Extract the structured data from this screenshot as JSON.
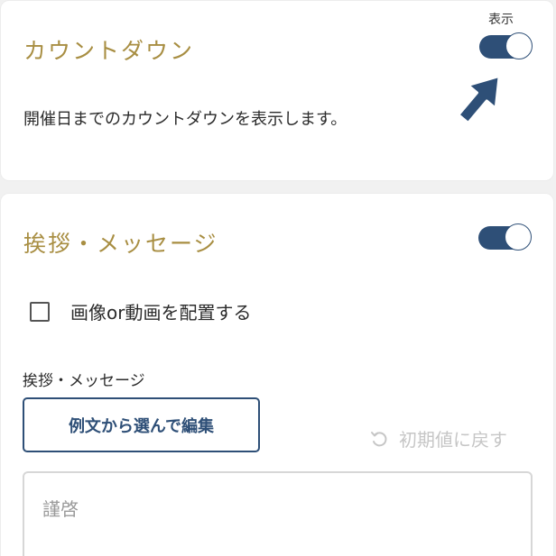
{
  "countdown": {
    "title": "カウントダウン",
    "toggle_caption": "表示",
    "toggle_on": true,
    "description": "開催日までのカウントダウンを表示します。"
  },
  "greeting": {
    "title": "挨拶・メッセージ",
    "toggle_on": true,
    "media_checkbox_label": "画像or動画を配置する",
    "media_checkbox_checked": false,
    "field_label": "挨拶・メッセージ",
    "example_button_label": "例文から選んで編集",
    "reset_label": "初期値に戻す",
    "message_value": "謹啓"
  },
  "colors": {
    "accent": "#2e4f77",
    "title_gold": "#a88e42",
    "disabled_text": "#c6c6c6"
  },
  "icons": {
    "pointer": "cursor-arrow-icon",
    "reset": "undo-icon"
  }
}
